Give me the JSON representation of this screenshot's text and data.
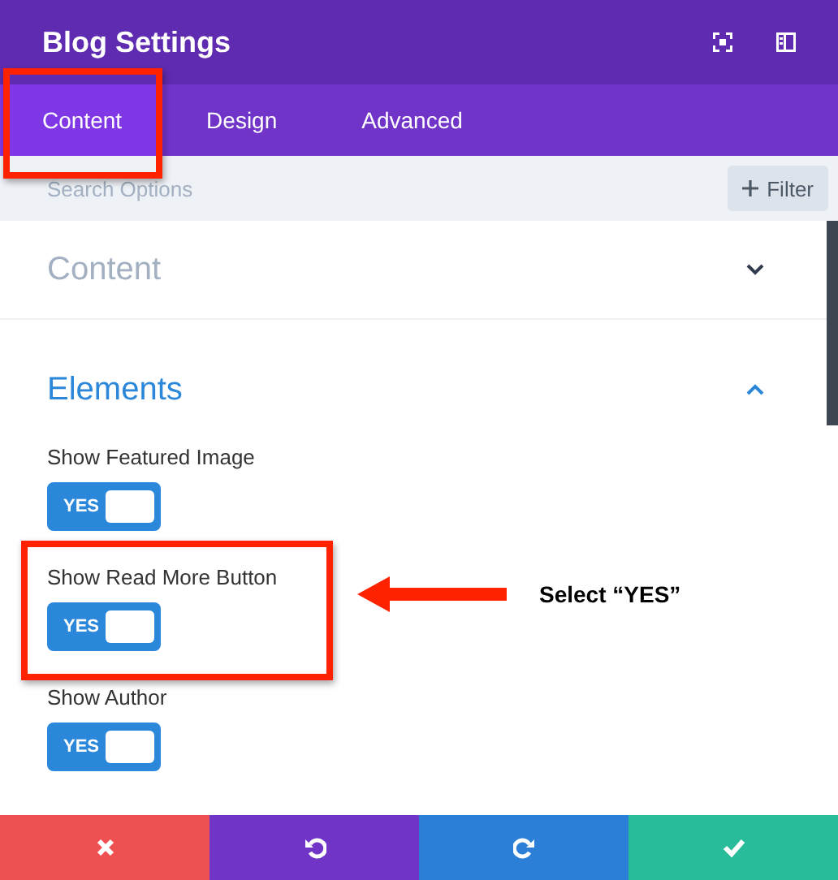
{
  "window": {
    "title": "Blog Settings"
  },
  "tabs": [
    {
      "label": "Content",
      "selected": true,
      "highlighted": true
    },
    {
      "label": "Design",
      "selected": false,
      "highlighted": false
    },
    {
      "label": "Advanced",
      "selected": false,
      "highlighted": false
    }
  ],
  "search": {
    "placeholder": "Search Options",
    "filter_label": "Filter"
  },
  "sections": [
    {
      "title": "Content",
      "expanded": false
    },
    {
      "title": "Elements",
      "expanded": true,
      "options": [
        {
          "label": "Show Featured Image",
          "on": true,
          "toggle_text": "YES",
          "highlighted": false
        },
        {
          "label": "Show Read More Button",
          "on": true,
          "toggle_text": "YES",
          "highlighted": true
        },
        {
          "label": "Show Author",
          "on": true,
          "toggle_text": "YES",
          "highlighted": false
        }
      ]
    }
  ],
  "annotation": {
    "text": "Select “YES”"
  },
  "footer": [
    {
      "kind": "cancel"
    },
    {
      "kind": "undo"
    },
    {
      "kind": "redo"
    },
    {
      "kind": "save"
    }
  ]
}
